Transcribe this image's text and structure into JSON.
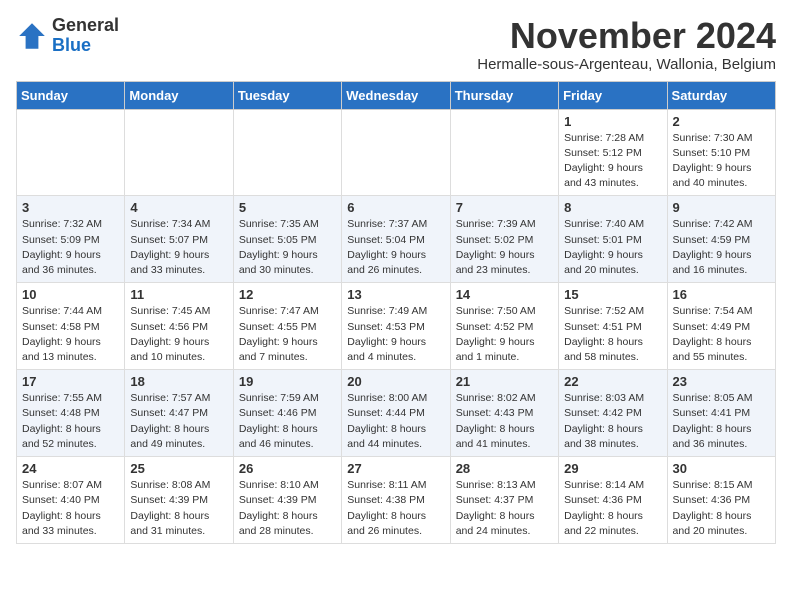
{
  "logo": {
    "general": "General",
    "blue": "Blue"
  },
  "title": "November 2024",
  "subtitle": "Hermalle-sous-Argenteau, Wallonia, Belgium",
  "weekdays": [
    "Sunday",
    "Monday",
    "Tuesday",
    "Wednesday",
    "Thursday",
    "Friday",
    "Saturday"
  ],
  "weeks": [
    [
      {
        "day": "",
        "info": ""
      },
      {
        "day": "",
        "info": ""
      },
      {
        "day": "",
        "info": ""
      },
      {
        "day": "",
        "info": ""
      },
      {
        "day": "",
        "info": ""
      },
      {
        "day": "1",
        "info": "Sunrise: 7:28 AM\nSunset: 5:12 PM\nDaylight: 9 hours and 43 minutes."
      },
      {
        "day": "2",
        "info": "Sunrise: 7:30 AM\nSunset: 5:10 PM\nDaylight: 9 hours and 40 minutes."
      }
    ],
    [
      {
        "day": "3",
        "info": "Sunrise: 7:32 AM\nSunset: 5:09 PM\nDaylight: 9 hours and 36 minutes."
      },
      {
        "day": "4",
        "info": "Sunrise: 7:34 AM\nSunset: 5:07 PM\nDaylight: 9 hours and 33 minutes."
      },
      {
        "day": "5",
        "info": "Sunrise: 7:35 AM\nSunset: 5:05 PM\nDaylight: 9 hours and 30 minutes."
      },
      {
        "day": "6",
        "info": "Sunrise: 7:37 AM\nSunset: 5:04 PM\nDaylight: 9 hours and 26 minutes."
      },
      {
        "day": "7",
        "info": "Sunrise: 7:39 AM\nSunset: 5:02 PM\nDaylight: 9 hours and 23 minutes."
      },
      {
        "day": "8",
        "info": "Sunrise: 7:40 AM\nSunset: 5:01 PM\nDaylight: 9 hours and 20 minutes."
      },
      {
        "day": "9",
        "info": "Sunrise: 7:42 AM\nSunset: 4:59 PM\nDaylight: 9 hours and 16 minutes."
      }
    ],
    [
      {
        "day": "10",
        "info": "Sunrise: 7:44 AM\nSunset: 4:58 PM\nDaylight: 9 hours and 13 minutes."
      },
      {
        "day": "11",
        "info": "Sunrise: 7:45 AM\nSunset: 4:56 PM\nDaylight: 9 hours and 10 minutes."
      },
      {
        "day": "12",
        "info": "Sunrise: 7:47 AM\nSunset: 4:55 PM\nDaylight: 9 hours and 7 minutes."
      },
      {
        "day": "13",
        "info": "Sunrise: 7:49 AM\nSunset: 4:53 PM\nDaylight: 9 hours and 4 minutes."
      },
      {
        "day": "14",
        "info": "Sunrise: 7:50 AM\nSunset: 4:52 PM\nDaylight: 9 hours and 1 minute."
      },
      {
        "day": "15",
        "info": "Sunrise: 7:52 AM\nSunset: 4:51 PM\nDaylight: 8 hours and 58 minutes."
      },
      {
        "day": "16",
        "info": "Sunrise: 7:54 AM\nSunset: 4:49 PM\nDaylight: 8 hours and 55 minutes."
      }
    ],
    [
      {
        "day": "17",
        "info": "Sunrise: 7:55 AM\nSunset: 4:48 PM\nDaylight: 8 hours and 52 minutes."
      },
      {
        "day": "18",
        "info": "Sunrise: 7:57 AM\nSunset: 4:47 PM\nDaylight: 8 hours and 49 minutes."
      },
      {
        "day": "19",
        "info": "Sunrise: 7:59 AM\nSunset: 4:46 PM\nDaylight: 8 hours and 46 minutes."
      },
      {
        "day": "20",
        "info": "Sunrise: 8:00 AM\nSunset: 4:44 PM\nDaylight: 8 hours and 44 minutes."
      },
      {
        "day": "21",
        "info": "Sunrise: 8:02 AM\nSunset: 4:43 PM\nDaylight: 8 hours and 41 minutes."
      },
      {
        "day": "22",
        "info": "Sunrise: 8:03 AM\nSunset: 4:42 PM\nDaylight: 8 hours and 38 minutes."
      },
      {
        "day": "23",
        "info": "Sunrise: 8:05 AM\nSunset: 4:41 PM\nDaylight: 8 hours and 36 minutes."
      }
    ],
    [
      {
        "day": "24",
        "info": "Sunrise: 8:07 AM\nSunset: 4:40 PM\nDaylight: 8 hours and 33 minutes."
      },
      {
        "day": "25",
        "info": "Sunrise: 8:08 AM\nSunset: 4:39 PM\nDaylight: 8 hours and 31 minutes."
      },
      {
        "day": "26",
        "info": "Sunrise: 8:10 AM\nSunset: 4:39 PM\nDaylight: 8 hours and 28 minutes."
      },
      {
        "day": "27",
        "info": "Sunrise: 8:11 AM\nSunset: 4:38 PM\nDaylight: 8 hours and 26 minutes."
      },
      {
        "day": "28",
        "info": "Sunrise: 8:13 AM\nSunset: 4:37 PM\nDaylight: 8 hours and 24 minutes."
      },
      {
        "day": "29",
        "info": "Sunrise: 8:14 AM\nSunset: 4:36 PM\nDaylight: 8 hours and 22 minutes."
      },
      {
        "day": "30",
        "info": "Sunrise: 8:15 AM\nSunset: 4:36 PM\nDaylight: 8 hours and 20 minutes."
      }
    ]
  ]
}
